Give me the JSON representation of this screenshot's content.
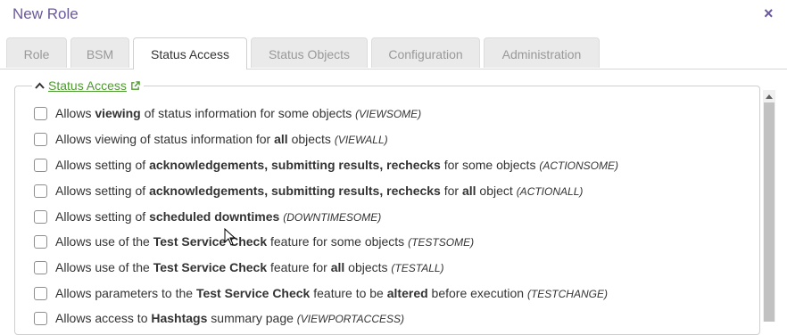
{
  "dialog": {
    "title": "New Role",
    "close_label": "×"
  },
  "tabs": [
    {
      "label": "Role",
      "active": false
    },
    {
      "label": "BSM",
      "active": false
    },
    {
      "label": "Status Access",
      "active": true
    },
    {
      "label": "Status Objects",
      "active": false
    },
    {
      "label": "Configuration",
      "active": false
    },
    {
      "label": "Administration",
      "active": false
    }
  ],
  "section": {
    "label": "Status Access",
    "link_color": "#4d9b2e"
  },
  "colors": {
    "accent": "#6a5a9a",
    "link": "#4d9b2e"
  },
  "icons": [
    "close-icon",
    "chevron-up-icon",
    "external-link-icon",
    "scroll-up-icon",
    "mouse-cursor-icon"
  ],
  "permissions": [
    {
      "segments": [
        {
          "t": "Allows ",
          "s": "n"
        },
        {
          "t": "viewing",
          "s": "b"
        },
        {
          "t": " of status information for some objects ",
          "s": "n"
        },
        {
          "t": "(VIEWSOME)",
          "s": "i"
        }
      ]
    },
    {
      "segments": [
        {
          "t": "Allows viewing of status information for ",
          "s": "n"
        },
        {
          "t": "all",
          "s": "b"
        },
        {
          "t": " objects ",
          "s": "n"
        },
        {
          "t": "(VIEWALL)",
          "s": "i"
        }
      ]
    },
    {
      "segments": [
        {
          "t": "Allows setting of ",
          "s": "n"
        },
        {
          "t": "acknowledgements, submitting results, rechecks",
          "s": "b"
        },
        {
          "t": " for some objects ",
          "s": "n"
        },
        {
          "t": "(ACTIONSOME)",
          "s": "i"
        }
      ]
    },
    {
      "segments": [
        {
          "t": "Allows setting of ",
          "s": "n"
        },
        {
          "t": "acknowledgements, submitting results, rechecks",
          "s": "b"
        },
        {
          "t": " for ",
          "s": "n"
        },
        {
          "t": "all",
          "s": "b"
        },
        {
          "t": " object ",
          "s": "n"
        },
        {
          "t": "(ACTIONALL)",
          "s": "i"
        }
      ]
    },
    {
      "segments": [
        {
          "t": "Allows setting of ",
          "s": "n"
        },
        {
          "t": "scheduled downtimes",
          "s": "b"
        },
        {
          "t": " ",
          "s": "n"
        },
        {
          "t": "(DOWNTIMESOME)",
          "s": "i"
        }
      ]
    },
    {
      "segments": [
        {
          "t": "Allows use of the ",
          "s": "n"
        },
        {
          "t": "Test Service Check",
          "s": "b"
        },
        {
          "t": " feature for some objects ",
          "s": "n"
        },
        {
          "t": "(TESTSOME)",
          "s": "i"
        }
      ]
    },
    {
      "segments": [
        {
          "t": "Allows use of the ",
          "s": "n"
        },
        {
          "t": "Test Service Check",
          "s": "b"
        },
        {
          "t": " feature for ",
          "s": "n"
        },
        {
          "t": "all",
          "s": "b"
        },
        {
          "t": " objects ",
          "s": "n"
        },
        {
          "t": "(TESTALL)",
          "s": "i"
        }
      ]
    },
    {
      "segments": [
        {
          "t": "Allows parameters to the ",
          "s": "n"
        },
        {
          "t": "Test Service Check",
          "s": "b"
        },
        {
          "t": " feature to be ",
          "s": "n"
        },
        {
          "t": "altered",
          "s": "b"
        },
        {
          "t": " before execution ",
          "s": "n"
        },
        {
          "t": "(TESTCHANGE)",
          "s": "i"
        }
      ]
    },
    {
      "segments": [
        {
          "t": "Allows access to ",
          "s": "n"
        },
        {
          "t": "Hashtags",
          "s": "b"
        },
        {
          "t": " summary page ",
          "s": "n"
        },
        {
          "t": "(VIEWPORTACCESS)",
          "s": "i"
        }
      ]
    }
  ]
}
